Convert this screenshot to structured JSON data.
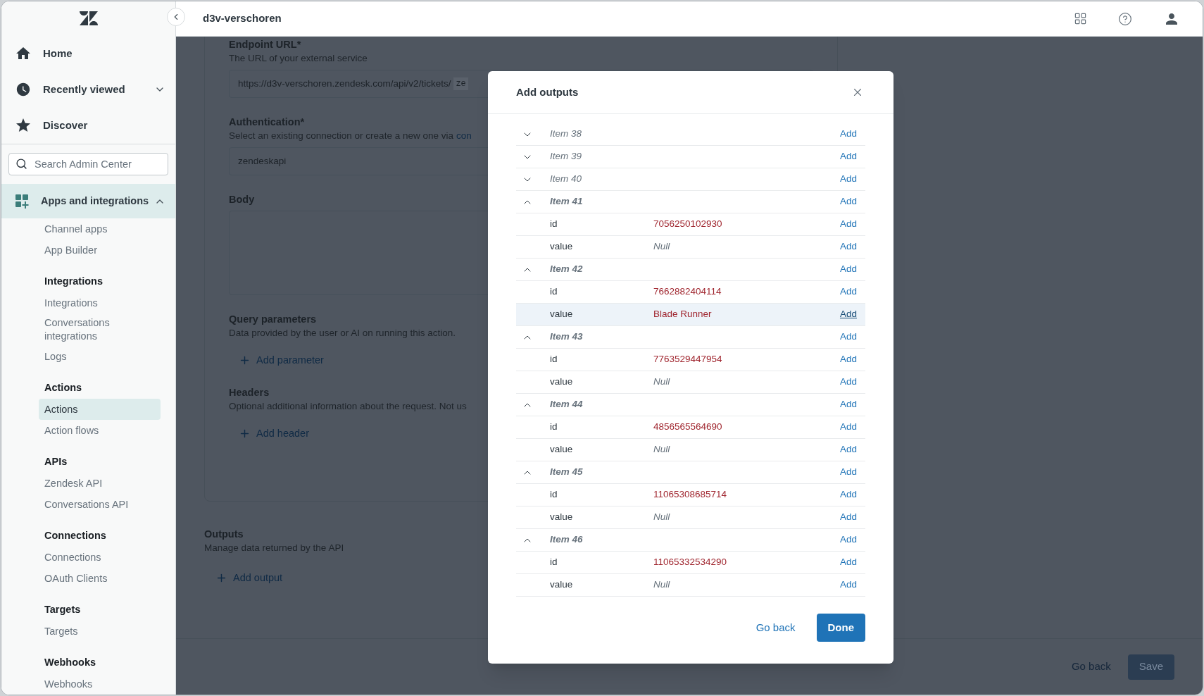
{
  "topbar": {
    "title": "d3v-verschoren"
  },
  "sidebar": {
    "nav": [
      {
        "label": "Home"
      },
      {
        "label": "Recently viewed",
        "expanded": false
      },
      {
        "label": "Discover"
      }
    ],
    "search": {
      "placeholder": "Search Admin Center"
    },
    "section": {
      "label": "Apps and integrations",
      "expanded": true,
      "selected": true
    },
    "groups": [
      {
        "items": [
          {
            "label": "Channel apps",
            "selected": false
          },
          {
            "label": "App Builder",
            "selected": false
          }
        ]
      },
      {
        "title": "Integrations",
        "items": [
          {
            "label": "Integrations",
            "selected": false
          },
          {
            "label": "Conversations integrations",
            "selected": false
          },
          {
            "label": "Logs",
            "selected": false
          }
        ]
      },
      {
        "title": "Actions",
        "items": [
          {
            "label": "Actions",
            "selected": true
          },
          {
            "label": "Action flows",
            "selected": false
          }
        ]
      },
      {
        "title": "APIs",
        "items": [
          {
            "label": "Zendesk API",
            "selected": false
          },
          {
            "label": "Conversations API",
            "selected": false
          }
        ]
      },
      {
        "title": "Connections",
        "items": [
          {
            "label": "Connections",
            "selected": false
          },
          {
            "label": "OAuth Clients",
            "selected": false
          }
        ]
      },
      {
        "title": "Targets",
        "items": [
          {
            "label": "Targets",
            "selected": false
          }
        ]
      },
      {
        "title": "Webhooks",
        "items": [
          {
            "label": "Webhooks",
            "selected": false
          }
        ]
      }
    ]
  },
  "form": {
    "fields": [
      {
        "kind": "input",
        "label": "Endpoint URL*",
        "description": "The URL of your external service",
        "value": "https://d3v-verschoren.zendesk.com/api/v2/tickets/",
        "chip": "ze"
      },
      {
        "kind": "input",
        "label": "Authentication*",
        "description": "Select an existing connection or create a new one via",
        "link": "con",
        "value": "zendeskapi"
      },
      {
        "kind": "textarea",
        "label": "Body"
      },
      {
        "kind": "list",
        "label": "Query parameters",
        "description": "Data provided by the user or AI on running this action.",
        "add": "Add parameter"
      },
      {
        "kind": "list",
        "label": "Headers",
        "description": "Optional additional information about the request. Not us",
        "add": "Add header"
      }
    ],
    "outputs": {
      "title": "Outputs",
      "description": "Manage data returned by the API",
      "add": "Add output"
    },
    "footer": {
      "back": "Go back",
      "save": "Save"
    }
  },
  "modal": {
    "title": "Add outputs",
    "items": [
      {
        "label": "Item 38",
        "expanded": false,
        "action": "Add"
      },
      {
        "label": "Item 39",
        "expanded": false,
        "action": "Add"
      },
      {
        "label": "Item 40",
        "expanded": false,
        "action": "Add"
      },
      {
        "label": "Item 41",
        "expanded": true,
        "action": "Add",
        "children": [
          {
            "key": "id",
            "value": "7056250102930",
            "kind": "value",
            "action": "Add",
            "selected": false
          },
          {
            "key": "value",
            "value": "Null",
            "kind": "null",
            "action": "Add",
            "selected": false
          }
        ]
      },
      {
        "label": "Item 42",
        "expanded": true,
        "action": "Add",
        "children": [
          {
            "key": "id",
            "value": "7662882404114",
            "kind": "value",
            "action": "Add",
            "selected": false
          },
          {
            "key": "value",
            "value": "Blade Runner",
            "kind": "value",
            "action": "Add",
            "selected": true
          }
        ]
      },
      {
        "label": "Item 43",
        "expanded": true,
        "action": "Add",
        "children": [
          {
            "key": "id",
            "value": "7763529447954",
            "kind": "value",
            "action": "Add",
            "selected": false
          },
          {
            "key": "value",
            "value": "Null",
            "kind": "null",
            "action": "Add",
            "selected": false
          }
        ]
      },
      {
        "label": "Item 44",
        "expanded": true,
        "action": "Add",
        "children": [
          {
            "key": "id",
            "value": "4856565564690",
            "kind": "value",
            "action": "Add",
            "selected": false
          },
          {
            "key": "value",
            "value": "Null",
            "kind": "null",
            "action": "Add",
            "selected": false
          }
        ]
      },
      {
        "label": "Item 45",
        "expanded": true,
        "action": "Add",
        "children": [
          {
            "key": "id",
            "value": "11065308685714",
            "kind": "value",
            "action": "Add",
            "selected": false
          },
          {
            "key": "value",
            "value": "Null",
            "kind": "null",
            "action": "Add",
            "selected": false
          }
        ]
      },
      {
        "label": "Item 46",
        "expanded": true,
        "action": "Add",
        "children": [
          {
            "key": "id",
            "value": "11065332534290",
            "kind": "value",
            "action": "Add",
            "selected": false
          },
          {
            "key": "value",
            "value": "Null",
            "kind": "null",
            "action": "Add",
            "selected": false
          }
        ]
      }
    ],
    "back": "Go back",
    "done": "Done"
  }
}
